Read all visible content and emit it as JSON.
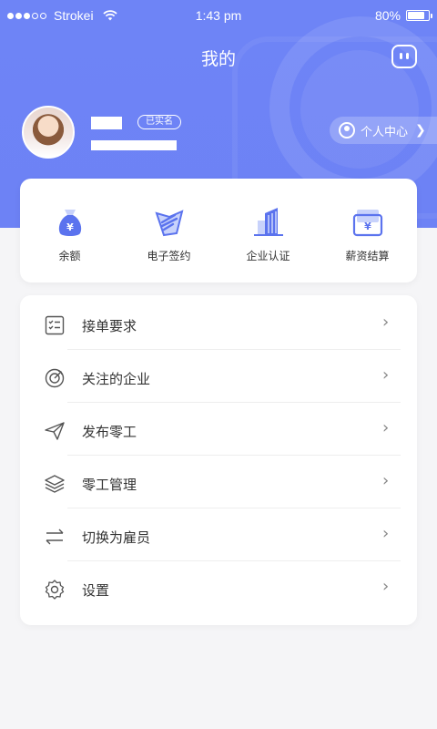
{
  "status_bar": {
    "carrier": "Strokei",
    "time": "1:43 pm",
    "battery": "80%",
    "battery_level": 0.8
  },
  "header": {
    "title": "我的",
    "message_icon": "chat-icon"
  },
  "profile": {
    "verified_badge": "已实名",
    "center_button": "个人中心"
  },
  "quick_actions": [
    {
      "label": "余额",
      "icon": "money-bag-icon"
    },
    {
      "label": "电子签约",
      "icon": "sign-icon"
    },
    {
      "label": "企业认证",
      "icon": "building-icon"
    },
    {
      "label": "薪资结算",
      "icon": "wallet-icon"
    }
  ],
  "menu": [
    {
      "label": "接单要求",
      "icon": "checklist-icon"
    },
    {
      "label": "关注的企业",
      "icon": "target-icon"
    },
    {
      "label": "发布零工",
      "icon": "send-icon"
    },
    {
      "label": "零工管理",
      "icon": "layers-icon"
    },
    {
      "label": "切换为雇员",
      "icon": "swap-icon"
    },
    {
      "label": "设置",
      "icon": "settings-icon"
    }
  ],
  "colors": {
    "primary": "#6e84f6",
    "icon_blue": "#5b73ee",
    "icon_light": "#c8d2fb"
  }
}
